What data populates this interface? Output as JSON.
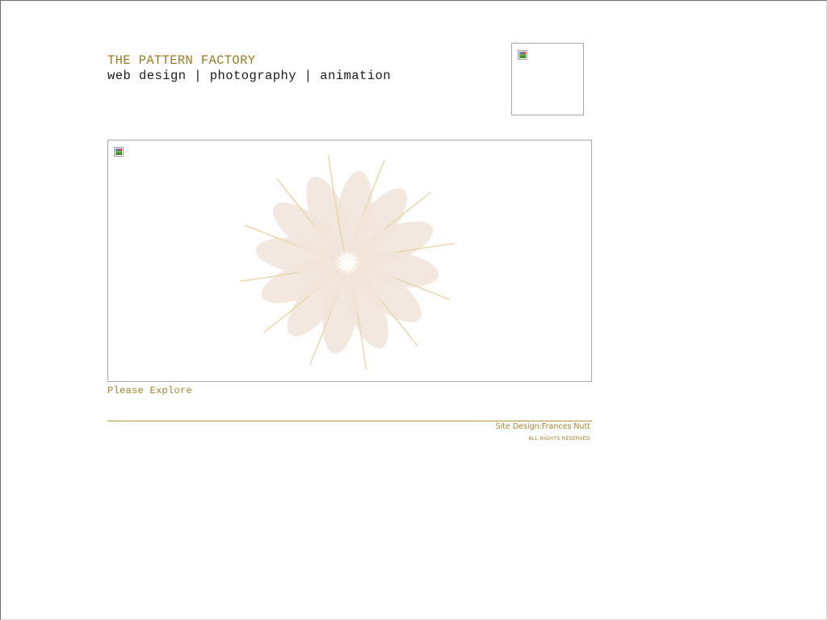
{
  "header": {
    "title": "THE PATTERN FACTORY",
    "tagline": "web design | photography | animation"
  },
  "logo_image": {
    "icon": "broken-image-icon"
  },
  "hero_image": {
    "icon": "broken-image-icon",
    "decoration": "flower-icon"
  },
  "explore": {
    "label": "Please Explore"
  },
  "footer": {
    "credit": "Site Design:Frances Nutt",
    "rights": "ALL RIGHTS RESERVED"
  },
  "colors": {
    "accent": "#9a7a1e",
    "link": "#a8822a",
    "divider": "#b8963a",
    "text": "#1a1a1a",
    "petal": "#f1e4da",
    "petal_vein": "#e6d6a6"
  }
}
